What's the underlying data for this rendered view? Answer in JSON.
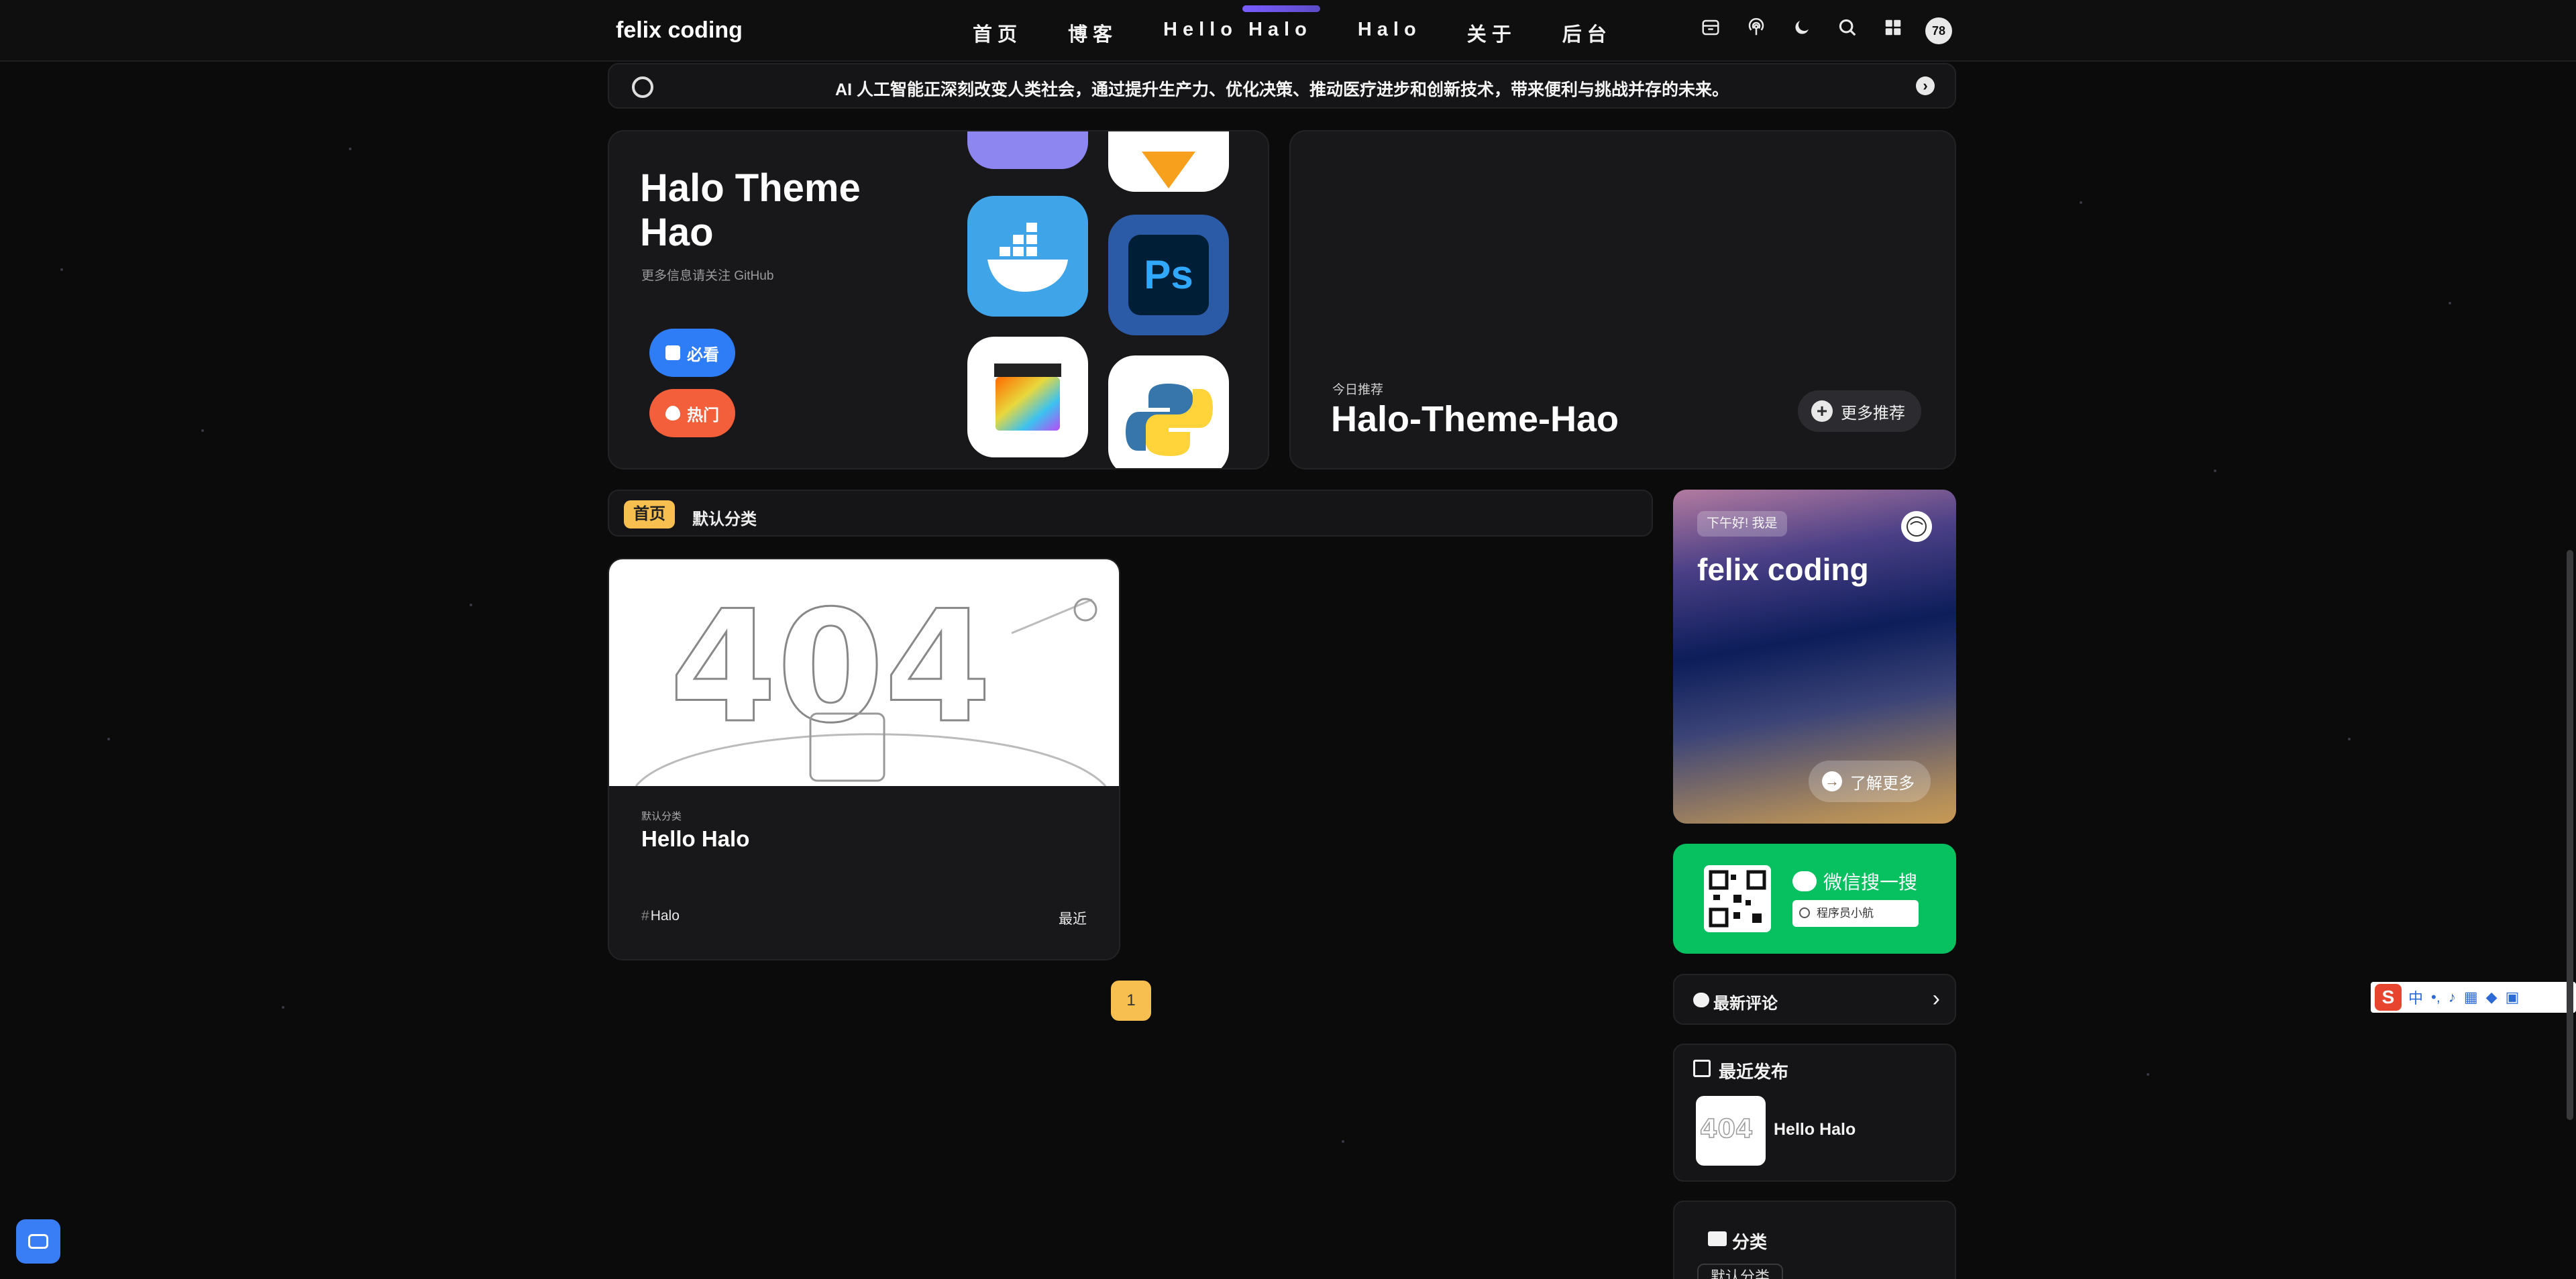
{
  "nav": {
    "logo": "felix coding",
    "menu": [
      "首页",
      "博客",
      "Hello Halo",
      "Halo",
      "关于",
      "后台"
    ],
    "avatar_badge": "78",
    "icons": [
      "archive-icon",
      "podcast-icon",
      "moon-icon",
      "search-icon",
      "grid-icon"
    ]
  },
  "announcement": {
    "text": "AI 人工智能正深刻改变人类社会，通过提升生产力、优化决策、推动医疗进步和创新技术，带来便利与挑战并存的未来。"
  },
  "hero": {
    "title": "Halo Theme Hao",
    "subtitle": "更多信息请关注 GitHub",
    "btn_must_see": "必看",
    "btn_hot": "热门",
    "apps": [
      "docker-icon",
      "photoshop-icon",
      "final-cut-pro-icon",
      "python-icon"
    ],
    "ps_label": "Ps"
  },
  "today": {
    "label": "今日推荐",
    "title": "Halo-Theme-Hao",
    "more_btn": "更多推荐"
  },
  "categories_bar": {
    "active": "首页",
    "item": "默认分类"
  },
  "post": {
    "category": "默认分类",
    "title": "Hello Halo",
    "tag": "Halo",
    "time": "最近",
    "image_text": "404"
  },
  "pager": {
    "current": "1"
  },
  "profile": {
    "greeting": "下午好! 我是",
    "name": "felix coding",
    "more_btn": "了解更多"
  },
  "wechat": {
    "title": "微信搜一搜",
    "search_value": "程序员小航"
  },
  "comments": {
    "title": "最新评论"
  },
  "recent": {
    "title": "最近发布",
    "post_title": "Hello Halo"
  },
  "sidebar_categories": {
    "title": "分类",
    "chip": "默认分类"
  },
  "ime": {
    "logo": "S",
    "mode": "中"
  },
  "colors": {
    "accent_yellow": "#f6bf4f",
    "blue": "#2f7df6",
    "orange": "#f25f3a",
    "wechat_green": "#07c160",
    "background": "#0b0b0c"
  }
}
